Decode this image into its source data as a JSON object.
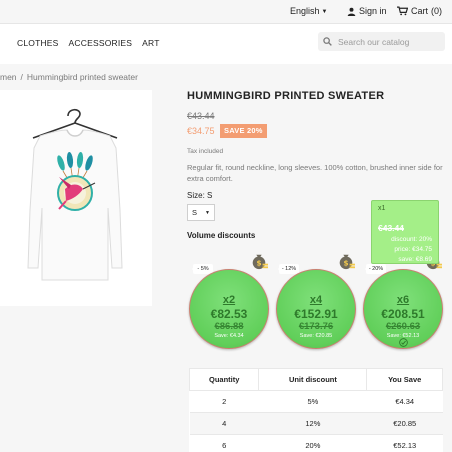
{
  "topbar": {
    "language": "English",
    "signin": "Sign in",
    "cart": "Cart",
    "cart_count": "(0)"
  },
  "nav": [
    "CLOTHES",
    "ACCESSORIES",
    "ART"
  ],
  "search": {
    "placeholder": "Search our catalog"
  },
  "breadcrumb": [
    "men",
    "Hummingbird printed sweater"
  ],
  "product": {
    "title": "HUMMINGBIRD PRINTED SWEATER",
    "old_price": "€43.44",
    "new_price": "€34.75",
    "save_badge": "SAVE 20%",
    "tax": "Tax included",
    "description": "Regular fit, round neckline, long sleeves. 100% cotton, brushed inner side for extra comfort.",
    "size_label": "Size: S",
    "size_value": "S"
  },
  "volume": {
    "title": "Volume discounts",
    "tooltip": {
      "head": "x1",
      "old": "€43.44",
      "discount": "discount: 20%",
      "price": "price: €34.75",
      "save": "save: €8.69"
    },
    "tiers": [
      {
        "tag": "- 5%",
        "qty": "x2",
        "price": "€82.53",
        "old": "€86.88",
        "save": "Save: €4.34"
      },
      {
        "tag": "- 12%",
        "qty": "x4",
        "price": "€152.91",
        "old": "€173.76",
        "save": "Save: €20.85"
      },
      {
        "tag": "- 20%",
        "qty": "x6",
        "price": "€208.51",
        "old": "€260.63",
        "save": "Save: €52.13"
      }
    ],
    "table": {
      "headers": [
        "Quantity",
        "Unit discount",
        "You Save"
      ],
      "rows": [
        [
          "2",
          "5%",
          "€4.34"
        ],
        [
          "4",
          "12%",
          "€20.85"
        ],
        [
          "6",
          "20%",
          "€52.13"
        ]
      ]
    }
  },
  "colors": {
    "accent": "#f39d72",
    "green": "#61cf5a",
    "tooltip": "#a4ef88"
  }
}
